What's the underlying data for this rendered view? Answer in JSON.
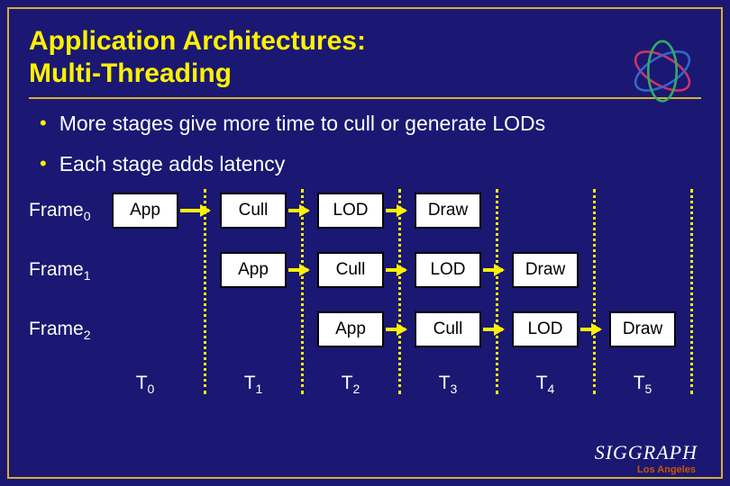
{
  "title_line1": "Application Architectures:",
  "title_line2": "Multi-Threading",
  "bullets": [
    "More stages give more time to cull or generate LODs",
    "Each stage adds latency"
  ],
  "frames": [
    "Frame",
    "Frame",
    "Frame"
  ],
  "frame_subs": [
    "0",
    "1",
    "2"
  ],
  "stages": [
    "App",
    "Cull",
    "LOD",
    "Draw"
  ],
  "times": [
    "T",
    "T",
    "T",
    "T",
    "T",
    "T"
  ],
  "time_subs": [
    "0",
    "1",
    "2",
    "3",
    "4",
    "5"
  ],
  "footer": "SIGGRAPH",
  "footer_sub": "Los Angeles",
  "layout": {
    "cols_x": [
      92,
      212,
      320,
      428,
      536,
      644,
      752
    ],
    "vlines_x": [
      194,
      302,
      410,
      518,
      626,
      734
    ]
  }
}
